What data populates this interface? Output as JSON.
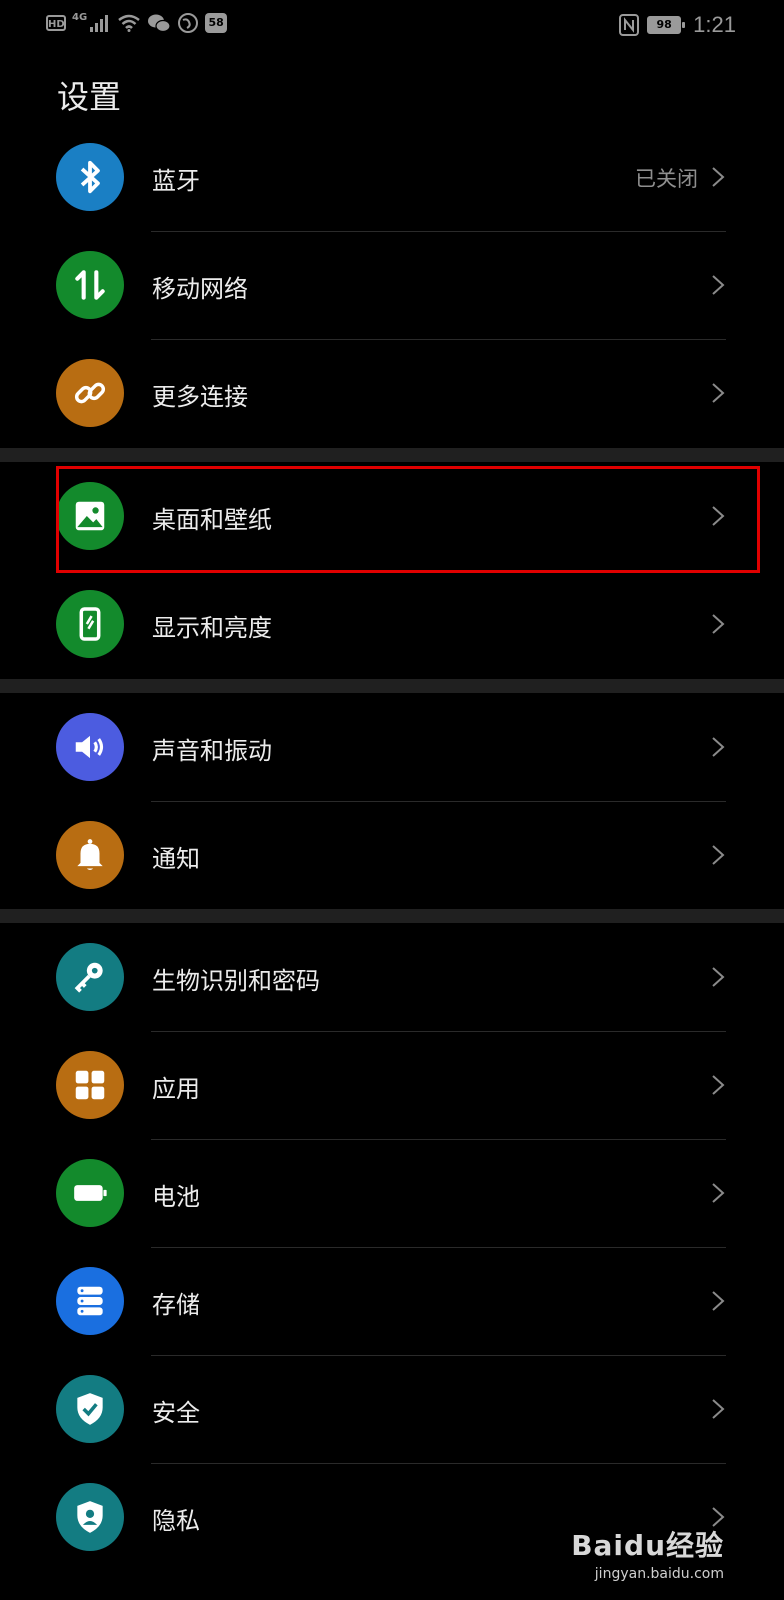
{
  "status_bar": {
    "hd_label": "HD",
    "network_label": "4G",
    "app_badge": "58",
    "battery_level": "98",
    "time": "1:21"
  },
  "page": {
    "title": "设置"
  },
  "rows": [
    {
      "id": "bluetooth",
      "label": "蓝牙",
      "value": "已关闭",
      "icon": "bluetooth-icon",
      "color": "#1a7fc4"
    },
    {
      "id": "mobile-network",
      "label": "移动网络",
      "value": "",
      "icon": "mobile-data-icon",
      "color": "#138a2c"
    },
    {
      "id": "more-connections",
      "label": "更多连接",
      "value": "",
      "icon": "link-icon",
      "color": "#b86d12"
    },
    {
      "id": "home-wallpaper",
      "label": "桌面和壁纸",
      "value": "",
      "icon": "image-icon",
      "color": "#138a2c"
    },
    {
      "id": "display-brightness",
      "label": "显示和亮度",
      "value": "",
      "icon": "phone-brightness-icon",
      "color": "#138a2c"
    },
    {
      "id": "sound-vibration",
      "label": "声音和振动",
      "value": "",
      "icon": "speaker-icon",
      "color": "#4c5ce0"
    },
    {
      "id": "notifications",
      "label": "通知",
      "value": "",
      "icon": "bell-icon",
      "color": "#b86d12"
    },
    {
      "id": "biometrics-password",
      "label": "生物识别和密码",
      "value": "",
      "icon": "key-icon",
      "color": "#137c82"
    },
    {
      "id": "apps",
      "label": "应用",
      "value": "",
      "icon": "apps-grid-icon",
      "color": "#b86d12"
    },
    {
      "id": "battery",
      "label": "电池",
      "value": "",
      "icon": "battery-icon",
      "color": "#138a2c"
    },
    {
      "id": "storage",
      "label": "存储",
      "value": "",
      "icon": "storage-icon",
      "color": "#1a6fe0"
    },
    {
      "id": "security",
      "label": "安全",
      "value": "",
      "icon": "shield-check-icon",
      "color": "#137c82"
    },
    {
      "id": "privacy",
      "label": "隐私",
      "value": "",
      "icon": "privacy-shield-icon",
      "color": "#137c82"
    }
  ],
  "highlighted_row": "home-wallpaper",
  "highlight_color": "#e00000",
  "watermark": {
    "brand": "Baidu经验",
    "url": "jingyan.baidu.com"
  }
}
